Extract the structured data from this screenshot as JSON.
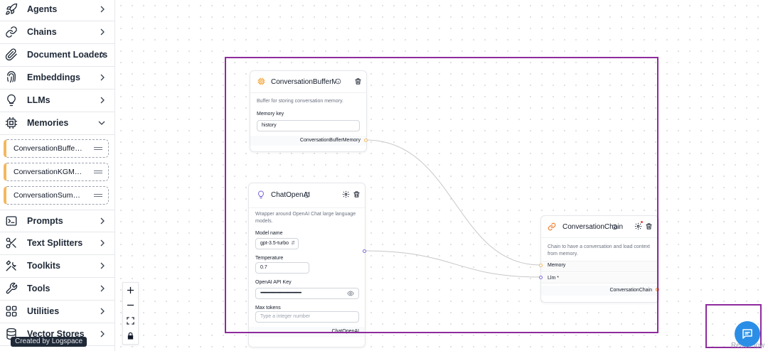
{
  "sidebar": {
    "categories": [
      {
        "label": "Agents",
        "icon": "rocket-icon"
      },
      {
        "label": "Chains",
        "icon": "link-icon"
      },
      {
        "label": "Document Loaders",
        "icon": "paperclip-icon"
      },
      {
        "label": "Embeddings",
        "icon": "fingerprint-icon"
      },
      {
        "label": "LLMs",
        "icon": "lightbulb-icon"
      },
      {
        "label": "Memories",
        "icon": "cpu-icon",
        "expanded": true
      },
      {
        "label": "Prompts",
        "icon": "terminal-icon"
      },
      {
        "label": "Text Splitters",
        "icon": "scissors-icon"
      },
      {
        "label": "Toolkits",
        "icon": "tools-icon"
      },
      {
        "label": "Tools",
        "icon": "wrench-icon"
      },
      {
        "label": "Utilities",
        "icon": "grid-icon"
      },
      {
        "label": "Vector Stores",
        "icon": "database-icon"
      }
    ],
    "memory_items": [
      {
        "label": "ConversationBufferMemory"
      },
      {
        "label": "ConversationKGMemory"
      },
      {
        "label": "ConversationSummaryMemory"
      }
    ],
    "badge": "Created by Logspace"
  },
  "nodes": {
    "buffer_memory": {
      "title": "ConversationBufferMe...",
      "description": "Buffer for storing conversation memory.",
      "field_label": "Memory key",
      "field_value": "history",
      "output": "ConversationBufferMemory"
    },
    "chat_openai": {
      "title": "ChatOpenAI",
      "description": "Wrapper around OpenAI Chat large language models.",
      "model_label": "Model name",
      "model_value": "gpt-3.5-turbo",
      "temp_label": "Temperature",
      "temp_value": "0.7",
      "key_label": "OpenAI API Key",
      "key_value": "••••••••••••••••••••••••••••••••••••••••••••••••••••",
      "max_label": "Max tokens",
      "max_placeholder": "Type a integer number",
      "output": "ChatOpenAI"
    },
    "conversation_chain": {
      "title": "ConversationChain",
      "description": "Chain to have a conversation and load context from memory.",
      "input_memory": "Memory",
      "input_llm": "Llm *",
      "output": "ConversationChain"
    }
  },
  "attribution": "ReactFlow",
  "colors": {
    "accent_memory": "#f4b860",
    "highlight": "#8e2b9d",
    "chat_button": "#2b8ee6"
  }
}
